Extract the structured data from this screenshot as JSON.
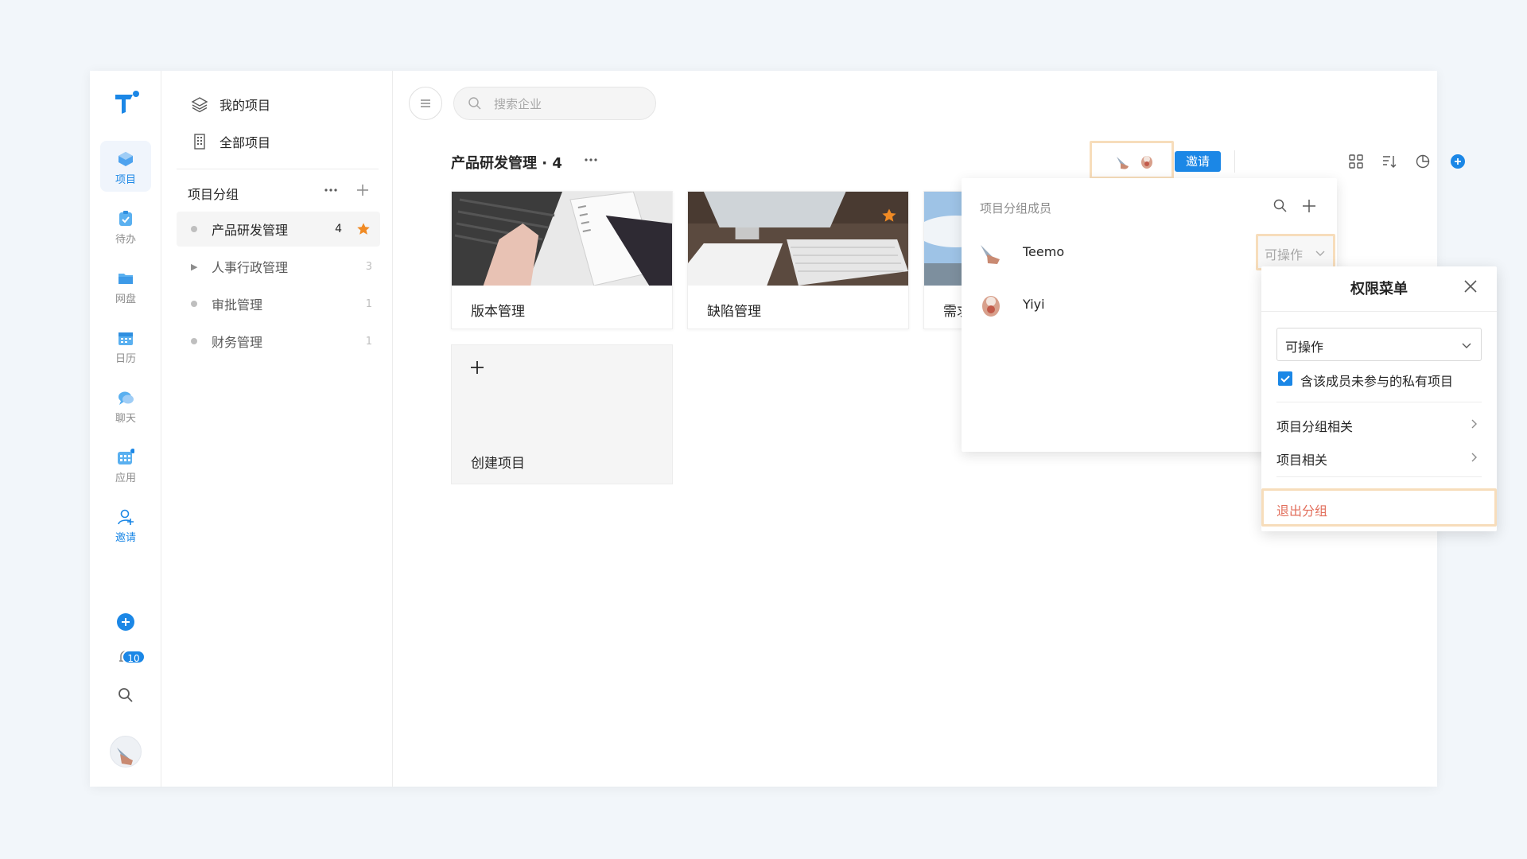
{
  "rail": {
    "items": [
      {
        "label": "项目",
        "icon": "project-icon"
      },
      {
        "label": "待办",
        "icon": "todo-icon"
      },
      {
        "label": "网盘",
        "icon": "folder-icon"
      },
      {
        "label": "日历",
        "icon": "calendar-icon"
      },
      {
        "label": "聊天",
        "icon": "chat-icon"
      },
      {
        "label": "应用",
        "icon": "apps-icon"
      },
      {
        "label": "邀请",
        "icon": "invite-user-icon"
      }
    ],
    "notification_count": "10"
  },
  "nav": {
    "my_projects": "我的项目",
    "all_projects": "全部项目"
  },
  "groups": {
    "header": "项目分组",
    "items": [
      {
        "label": "产品研发管理",
        "count": "4"
      },
      {
        "label": "人事行政管理",
        "count": "3"
      },
      {
        "label": "审批管理",
        "count": "1"
      },
      {
        "label": "财务管理",
        "count": "1"
      }
    ]
  },
  "search": {
    "placeholder": "搜索企业"
  },
  "main": {
    "title": "产品研发管理 · 4",
    "invite_label": "邀请",
    "cards": [
      {
        "name": "版本管理"
      },
      {
        "name": "缺陷管理"
      },
      {
        "name": "需求"
      }
    ],
    "create_label": "创建项目"
  },
  "members_popover": {
    "title": "项目分组成员",
    "members": [
      {
        "name": "Teemo"
      },
      {
        "name": "Yiyi"
      }
    ],
    "permission_value": "可操作"
  },
  "permission_menu": {
    "title": "权限菜单",
    "select_value": "可操作",
    "checkbox_label": "含该成员未参与的私有项目",
    "checkbox_checked": true,
    "rows": [
      {
        "label": "项目分组相关"
      },
      {
        "label": "项目相关"
      }
    ],
    "exit_label": "退出分组"
  },
  "colors": {
    "accent": "#1b87e6",
    "star": "#f08a24",
    "danger": "#e26f5c",
    "highlight": "#f7ddbb"
  }
}
